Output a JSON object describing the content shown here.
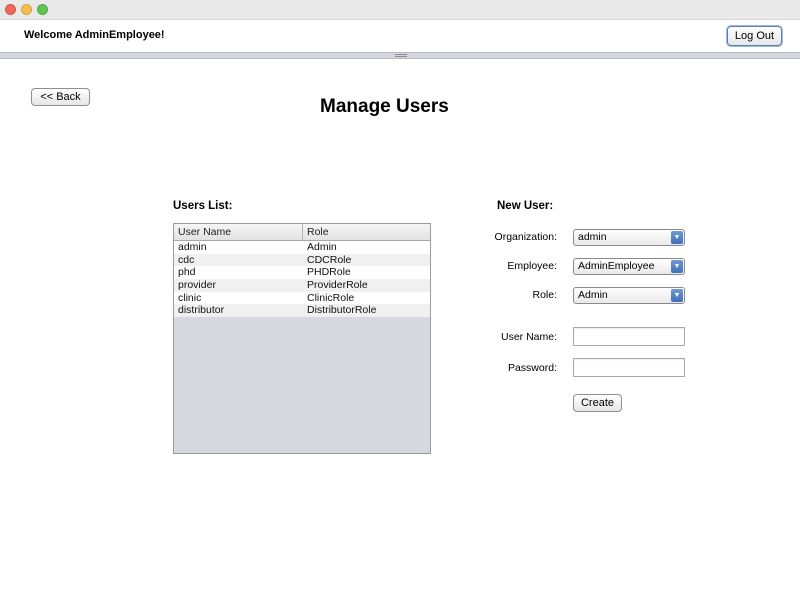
{
  "header": {
    "welcome": "Welcome AdminEmployee!",
    "logout_label": "Log Out"
  },
  "nav": {
    "back_label": "<< Back"
  },
  "page": {
    "title": "Manage Users"
  },
  "users_list": {
    "label": "Users List:",
    "columns": [
      "User Name",
      "Role"
    ],
    "rows": [
      [
        "admin",
        "Admin"
      ],
      [
        "cdc",
        "CDCRole"
      ],
      [
        "phd",
        "PHDRole"
      ],
      [
        "provider",
        "ProviderRole"
      ],
      [
        "clinic",
        "ClinicRole"
      ],
      [
        "distributor",
        "DistributorRole"
      ]
    ]
  },
  "new_user": {
    "label": "New User:",
    "organization_label": "Organization:",
    "organization_value": "admin",
    "employee_label": "Employee:",
    "employee_value": "AdminEmployee",
    "role_label": "Role:",
    "role_value": "Admin",
    "username_label": "User Name:",
    "username_value": "",
    "password_label": "Password:",
    "password_value": "",
    "create_label": "Create"
  },
  "icons": {
    "dropdown": "triangle-down-icon"
  },
  "colors": {
    "accent": "#3f6fb7",
    "table_empty": "#d5d8df"
  }
}
